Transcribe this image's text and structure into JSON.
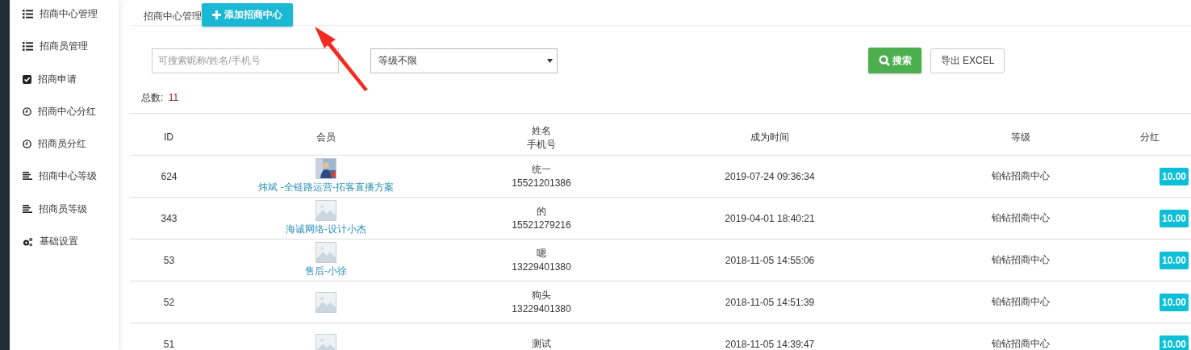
{
  "sidebar": {
    "items": [
      {
        "label": "招商中心管理",
        "kind": "list"
      },
      {
        "label": "招商员管理",
        "kind": "list"
      },
      {
        "label": "招商申请",
        "kind": "check"
      },
      {
        "label": "招商中心分红",
        "kind": "clock"
      },
      {
        "label": "招商员分红",
        "kind": "clock"
      },
      {
        "label": "招商中心等级",
        "kind": "lines"
      },
      {
        "label": "招商员等级",
        "kind": "lines"
      },
      {
        "label": "基础设置",
        "kind": "gears"
      }
    ]
  },
  "header": {
    "title": "招商中心管理",
    "add_button": "添加招商中心"
  },
  "filters": {
    "search": {
      "placeholder": "可搜索昵称/姓名/手机号"
    },
    "level_select": "等级不限",
    "search_button": "搜索",
    "export_button": "导出 EXCEL"
  },
  "total": {
    "label": "总数:",
    "value": "11"
  },
  "table": {
    "columns": [
      "ID",
      "会员",
      [
        "姓名",
        "手机号"
      ],
      "成为时间",
      "等级",
      "分红"
    ],
    "rows": [
      {
        "id": "624",
        "member": "炜斌 -全链路运营-拓客直播方案",
        "name": "统一",
        "phone": "15521201386",
        "time": "2019-07-24 09:36:34",
        "level": "铂钻招商中心",
        "ratio": "10.00"
      },
      {
        "id": "343",
        "avatar": {
          "kind": "placeholder"
        },
        "member": "海诚网络-设计小杰",
        "name": "的",
        "phone": "15521279216",
        "time": "2019-04-01 18:40:21",
        "level": "铂钻招商中心",
        "ratio": "10.00"
      },
      {
        "id": "53",
        "avatar": {
          "kind": "placeholder"
        },
        "member": "售后-小徐",
        "name": "嗯",
        "phone": "13229401380",
        "time": "2018-11-05 14:55:06",
        "level": "铂钻招商中心",
        "ratio": "10.00"
      },
      {
        "id": "52",
        "avatar": {
          "kind": "placeholder"
        },
        "name": "狗头",
        "phone": "13229401380",
        "time": "2018-11-05 14:51:39",
        "level": "铂钻招商中心",
        "ratio": "10.00"
      },
      {
        "id": "51",
        "avatar": {
          "kind": "placeholder"
        },
        "name": "测试",
        "time": "2018-11-05 14:39:47",
        "level": "铂钻招商中心",
        "ratio": "10.00"
      }
    ]
  },
  "annotation": {
    "kind": "arrow"
  }
}
